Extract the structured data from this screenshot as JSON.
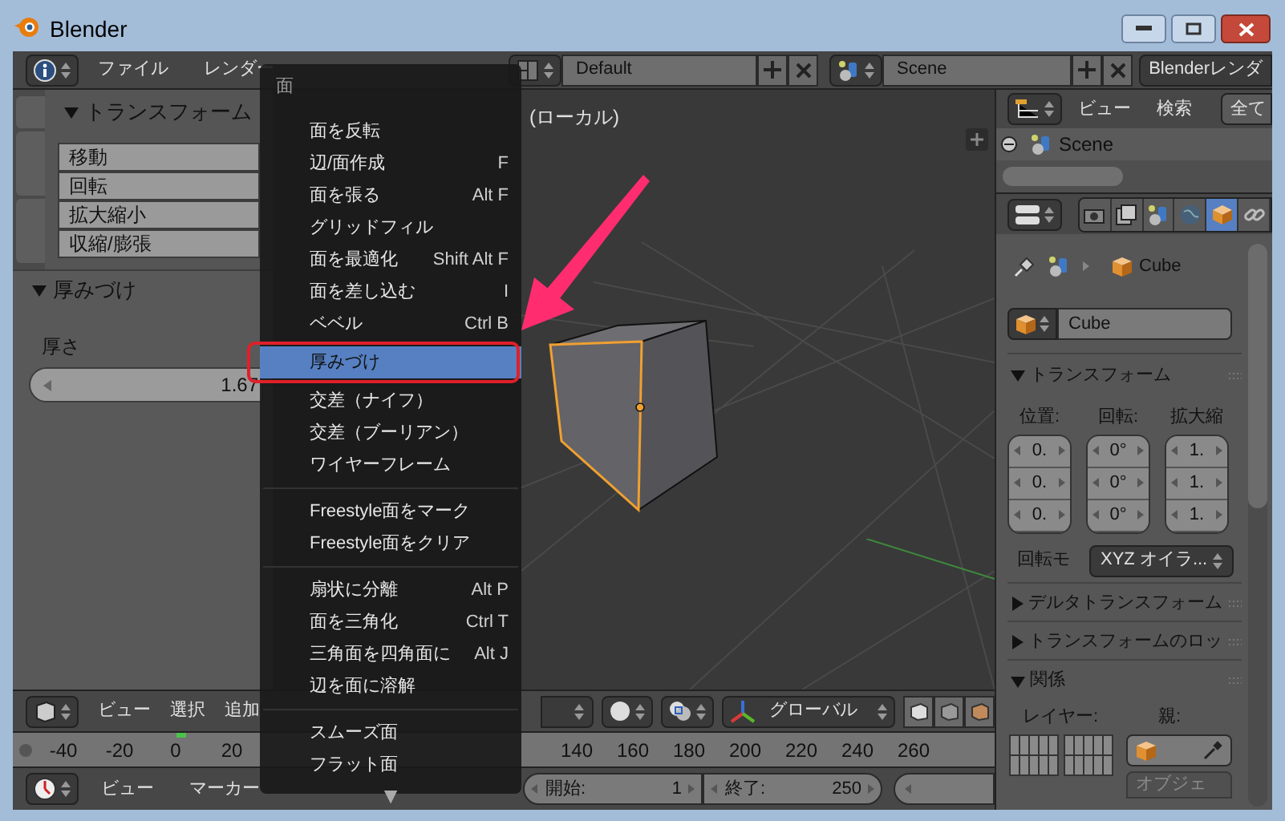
{
  "window": {
    "title": "Blender"
  },
  "info_header": {
    "menus": [
      "ファイル",
      "レンダー"
    ],
    "layout": "Default",
    "scene": "Scene",
    "engine": "Blenderレンダ"
  },
  "tool_shelf": {
    "title": "トランスフォーム",
    "expanded": true,
    "buttons": [
      "移動",
      "回転",
      "拡大縮小",
      "収縮/膨張"
    ]
  },
  "operator_panel": {
    "title": "厚みづけ",
    "expanded": true,
    "label": "厚さ",
    "value": "1.67"
  },
  "viewport": {
    "label": "(ローカル)"
  },
  "face_menu": {
    "title": "面",
    "more": "▼",
    "sections": [
      [
        {
          "label": "面を反転",
          "selected": false
        },
        {
          "label": "辺/面作成",
          "shortcut": "F",
          "selected": false
        },
        {
          "label": "面を張る",
          "shortcut": "Alt F",
          "selected": false
        },
        {
          "label": "グリッドフィル",
          "selected": false
        },
        {
          "label": "面を最適化",
          "shortcut": "Shift Alt F",
          "selected": false
        },
        {
          "label": "面を差し込む",
          "shortcut": "I",
          "selected": false
        },
        {
          "label": "ベベル",
          "shortcut": "Ctrl B",
          "selected": false
        },
        {
          "label": "厚みづけ",
          "selected": true
        },
        {
          "label": "交差（ナイフ）",
          "selected": false
        },
        {
          "label": "交差（ブーリアン）",
          "selected": false
        },
        {
          "label": "ワイヤーフレーム",
          "selected": false
        }
      ],
      [
        {
          "label": "Freestyle面をマーク",
          "selected": false
        },
        {
          "label": "Freestyle面をクリア",
          "selected": false
        }
      ],
      [
        {
          "label": "扇状に分離",
          "shortcut": "Alt P",
          "selected": false
        },
        {
          "label": "面を三角化",
          "shortcut": "Ctrl T",
          "selected": false
        },
        {
          "label": "三角面を四角面に",
          "shortcut": "Alt J",
          "selected": false
        },
        {
          "label": "辺を面に溶解",
          "selected": false
        }
      ],
      [
        {
          "label": "スムーズ面",
          "selected": false
        },
        {
          "label": "フラット面",
          "selected": false
        }
      ]
    ]
  },
  "viewport_header": {
    "menus": [
      "ビュー",
      "選択",
      "追加"
    ],
    "orientation": "グローバル"
  },
  "timeline_ruler": {
    "tick_groups": [
      [
        "-40",
        "-20",
        "0",
        "20"
      ],
      [
        "140",
        "160",
        "180",
        "200",
        "220",
        "240",
        "260"
      ]
    ]
  },
  "timeline_header": {
    "menus": [
      "ビュー",
      "マーカー"
    ],
    "start_label": "開始:",
    "start": "1",
    "end_label": "終了:",
    "end": "250"
  },
  "outliner": {
    "menus": [
      "ビュー",
      "検索"
    ],
    "filter": "全て",
    "rows": [
      {
        "label": "Scene",
        "expanded": true
      }
    ]
  },
  "properties": {
    "tabs": [
      {
        "kind": "camera",
        "selected": false
      },
      {
        "kind": "layers",
        "selected": false
      },
      {
        "kind": "scene",
        "selected": false
      },
      {
        "kind": "world",
        "selected": false
      },
      {
        "kind": "object",
        "selected": true
      },
      {
        "kind": "constraint",
        "selected": false
      }
    ],
    "breadcrumb": "Cube",
    "object_name": "Cube",
    "transform": {
      "title": "トランスフォーム",
      "expanded": true,
      "columns": [
        {
          "label": "位置:",
          "values": [
            "0.",
            "0.",
            "0."
          ]
        },
        {
          "label": "回転:",
          "values": [
            "0°",
            "0°",
            "0°"
          ]
        },
        {
          "label": "拡大縮",
          "values": [
            "1.",
            "1.",
            "1."
          ]
        }
      ],
      "rotation_mode_label": "回転モ",
      "rotation_mode": "XYZ オイラ..."
    },
    "panels": [
      {
        "title": "デルタトランスフォーム",
        "expanded": false
      },
      {
        "title": "トランスフォームのロッ",
        "expanded": false
      },
      {
        "title": "関係",
        "expanded": true
      }
    ],
    "relations": {
      "layer_label": "レイヤー:",
      "parent_label": "親:",
      "parent_type": "オブジェ",
      "parent_type_disabled": true
    }
  }
}
